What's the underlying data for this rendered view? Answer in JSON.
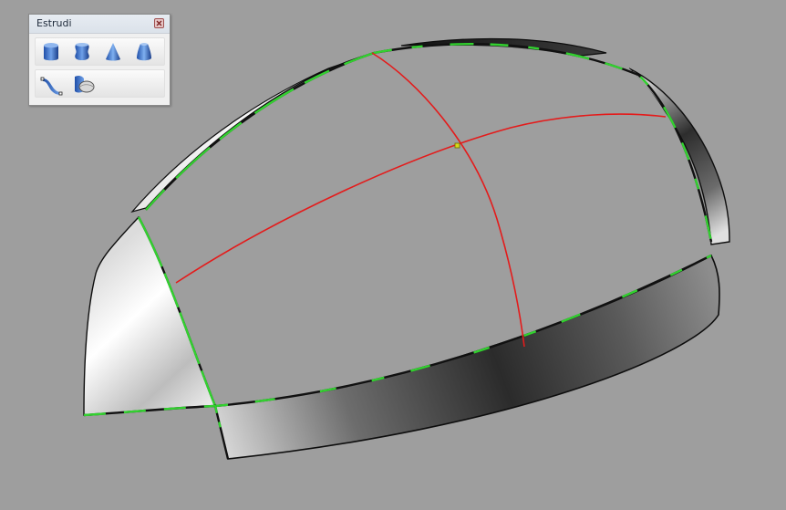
{
  "palette": {
    "title": "Estrudi",
    "tools_row1": [
      {
        "name": "extrude-straight-icon"
      },
      {
        "name": "extrude-tapered-icon"
      },
      {
        "name": "extrude-to-point-icon"
      },
      {
        "name": "extrude-ribbed-icon"
      }
    ],
    "tools_row2": [
      {
        "name": "extrude-along-curve-icon"
      },
      {
        "name": "extrude-to-surface-icon"
      }
    ]
  },
  "viewport": {
    "background": "#9e9e9e",
    "colors": {
      "isocurve": "#e41b1b",
      "naked_edge": "#32d12f",
      "edge": "#111111"
    }
  }
}
